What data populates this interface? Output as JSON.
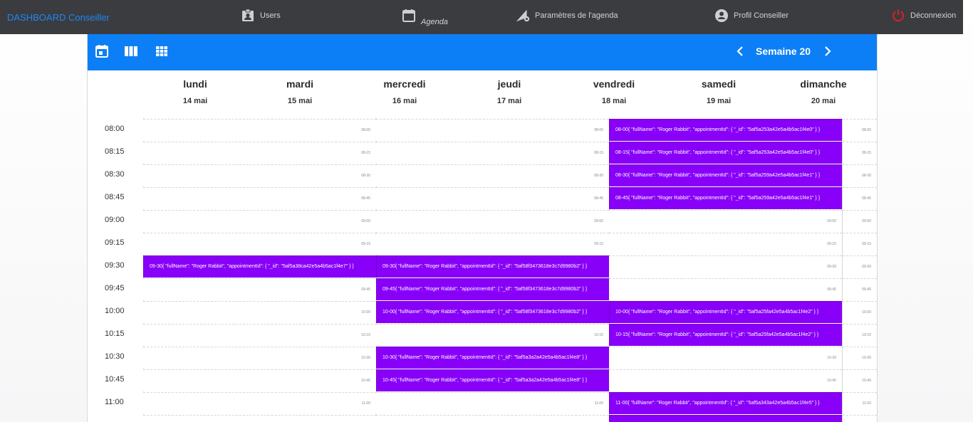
{
  "nav": {
    "brand": "DASHBOARD Conseiller",
    "users": "Users",
    "agenda": "Agenda",
    "settings": "Paramètres de l'agenda",
    "profile": "Profil Conseiller",
    "logout": "Déconnexion"
  },
  "colors": {
    "nav_bg": "#3b3c40",
    "brand": "#1f87f5",
    "toolbar": "#0d7ff6",
    "booked": "#8800f8",
    "logout_icon": "#e02020"
  },
  "toolbar": {
    "week_label": "Semaine 20",
    "icons": [
      "calendar-day-icon",
      "week-columns-icon",
      "month-grid-icon"
    ]
  },
  "days": [
    {
      "name": "lundi",
      "date": "14 mai"
    },
    {
      "name": "mardi",
      "date": "15 mai"
    },
    {
      "name": "mercredi",
      "date": "16 mai"
    },
    {
      "name": "jeudi",
      "date": "17 mai"
    },
    {
      "name": "vendredi",
      "date": "18 mai"
    },
    {
      "name": "samedi",
      "date": "19 mai"
    },
    {
      "name": "dimanche",
      "date": "20 mai"
    }
  ],
  "slots": [
    {
      "time": "08:00",
      "small": "08-00",
      "cells": [
        {
          "text": ""
        },
        {
          "text": ""
        },
        {
          "text": "08-00{ \"fullName\": \"Roger Rabbit\", \"appointmentId\": { \"_id\": \"5af5a253a42e5a4b5ac1f4e0\" } }",
          "booked": true
        }
      ]
    },
    {
      "time": "08:15",
      "small": "08-15",
      "cells": [
        {
          "text": ""
        },
        {
          "text": ""
        },
        {
          "text": "08-15{ \"fullName\": \"Roger Rabbit\", \"appointmentId\": { \"_id\": \"5af5a253a42e5a4b5ac1f4e0\" } }",
          "booked": true
        }
      ]
    },
    {
      "time": "08:30",
      "small": "08-30",
      "cells": [
        {
          "text": ""
        },
        {
          "text": ""
        },
        {
          "text": "08-30{ \"fullName\": \"Roger Rabbit\", \"appointmentId\": { \"_id\": \"5af5a259a42e5a4b5ac1f4e1\" } }",
          "booked": true
        }
      ]
    },
    {
      "time": "08:45",
      "small": "08-45",
      "cells": [
        {
          "text": ""
        },
        {
          "text": ""
        },
        {
          "text": "08-45{ \"fullName\": \"Roger Rabbit\", \"appointmentId\": { \"_id\": \"5af5a259a42e5a4b5ac1f4e1\" } }",
          "booked": true
        }
      ]
    },
    {
      "time": "09:00",
      "small": "09-00",
      "cells": [
        {
          "text": ""
        },
        {
          "text": ""
        },
        {
          "text": ""
        }
      ]
    },
    {
      "time": "09:15",
      "small": "09-15",
      "cells": [
        {
          "text": ""
        },
        {
          "text": ""
        },
        {
          "text": ""
        }
      ]
    },
    {
      "time": "09:30",
      "small": "09-30",
      "cells": [
        {
          "text": "09-30{ \"fullName\": \"Roger Rabbit\", \"appointmentId\": { \"_id\": \"5af5a38ca42e5a4b5ac1f4e7\" } }",
          "booked": true
        },
        {
          "text": "09-30{ \"fullName\": \"Roger Rabbit\", \"appointmentId\": { \"_id\": \"5af58f3473618e3c7d9980b2\" } }",
          "booked": true
        },
        {
          "text": ""
        }
      ]
    },
    {
      "time": "09:45",
      "small": "09-45",
      "cells": [
        {
          "text": ""
        },
        {
          "text": "09-45{ \"fullName\": \"Roger Rabbit\", \"appointmentId\": { \"_id\": \"5af58f3473618e3c7d9980b2\" } }",
          "booked": true
        },
        {
          "text": ""
        }
      ]
    },
    {
      "time": "10:00",
      "small": "10-00",
      "cells": [
        {
          "text": ""
        },
        {
          "text": "10-00{ \"fullName\": \"Roger Rabbit\", \"appointmentId\": { \"_id\": \"5af58f3473618e3c7d9980b2\" } }",
          "booked": true
        },
        {
          "text": "10-00{ \"fullName\": \"Roger Rabbit\", \"appointmentId\": { \"_id\": \"5af5a25fa42e5a4b5ac1f4e2\" } }",
          "booked": true
        }
      ]
    },
    {
      "time": "10:15",
      "small": "10-15",
      "cells": [
        {
          "text": ""
        },
        {
          "text": ""
        },
        {
          "text": "10-15{ \"fullName\": \"Roger Rabbit\", \"appointmentId\": { \"_id\": \"5af5a25fa42e5a4b5ac1f4e2\" } }",
          "booked": true
        }
      ]
    },
    {
      "time": "10:30",
      "small": "10-30",
      "cells": [
        {
          "text": ""
        },
        {
          "text": "10-30{ \"fullName\": \"Roger Rabbit\", \"appointmentId\": { \"_id\": \"5af5a3a2a42e5a4b5ac1f4e8\" } }",
          "booked": true
        },
        {
          "text": ""
        }
      ]
    },
    {
      "time": "10:45",
      "small": "10-45",
      "cells": [
        {
          "text": ""
        },
        {
          "text": "10-45{ \"fullName\": \"Roger Rabbit\", \"appointmentId\": { \"_id\": \"5af5a3a2a42e5a4b5ac1f4e8\" } }",
          "booked": true
        },
        {
          "text": ""
        }
      ]
    },
    {
      "time": "11:00",
      "small": "11-00",
      "cells": [
        {
          "text": ""
        },
        {
          "text": ""
        },
        {
          "text": "11-00{ \"fullName\": \"Roger Rabbit\", \"appointmentId\": { \"_id\": \"5af5a343a42e5a4b5ac1f4e5\" } }",
          "booked": true
        }
      ]
    },
    {
      "time": "",
      "small": "",
      "cells": [
        {
          "text": ""
        },
        {
          "text": ""
        },
        {
          "text": "",
          "booked": true
        }
      ]
    }
  ]
}
